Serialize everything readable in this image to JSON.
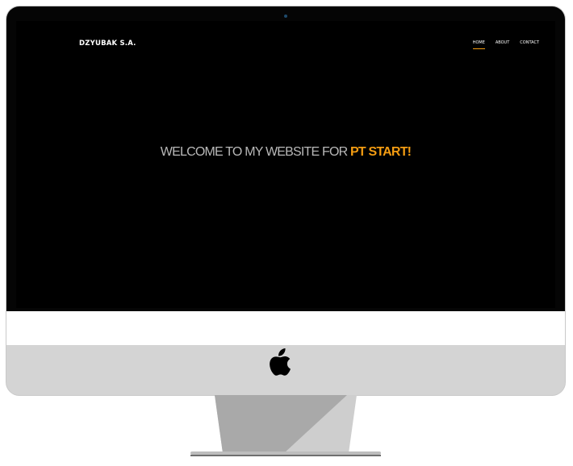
{
  "site": {
    "brand": "DZYUBAK S.A.",
    "nav": [
      {
        "label": "HOME",
        "active": true
      },
      {
        "label": "ABOUT",
        "active": false
      },
      {
        "label": "CONTACT",
        "active": false
      }
    ],
    "hero": {
      "text": "WELCOME TO MY WEBSITE FOR ",
      "accent": "PT START!"
    }
  },
  "colors": {
    "accent": "#f39c12",
    "screen_background": "#000000",
    "hero_text": "#b9b9b9",
    "monitor_body": "#d4d4d4",
    "stand_dark": "#a9a9a9",
    "stand_light": "#cecece"
  },
  "device": {
    "logo_icon": "apple-logo-icon",
    "camera_icon": "camera-dot-icon"
  }
}
